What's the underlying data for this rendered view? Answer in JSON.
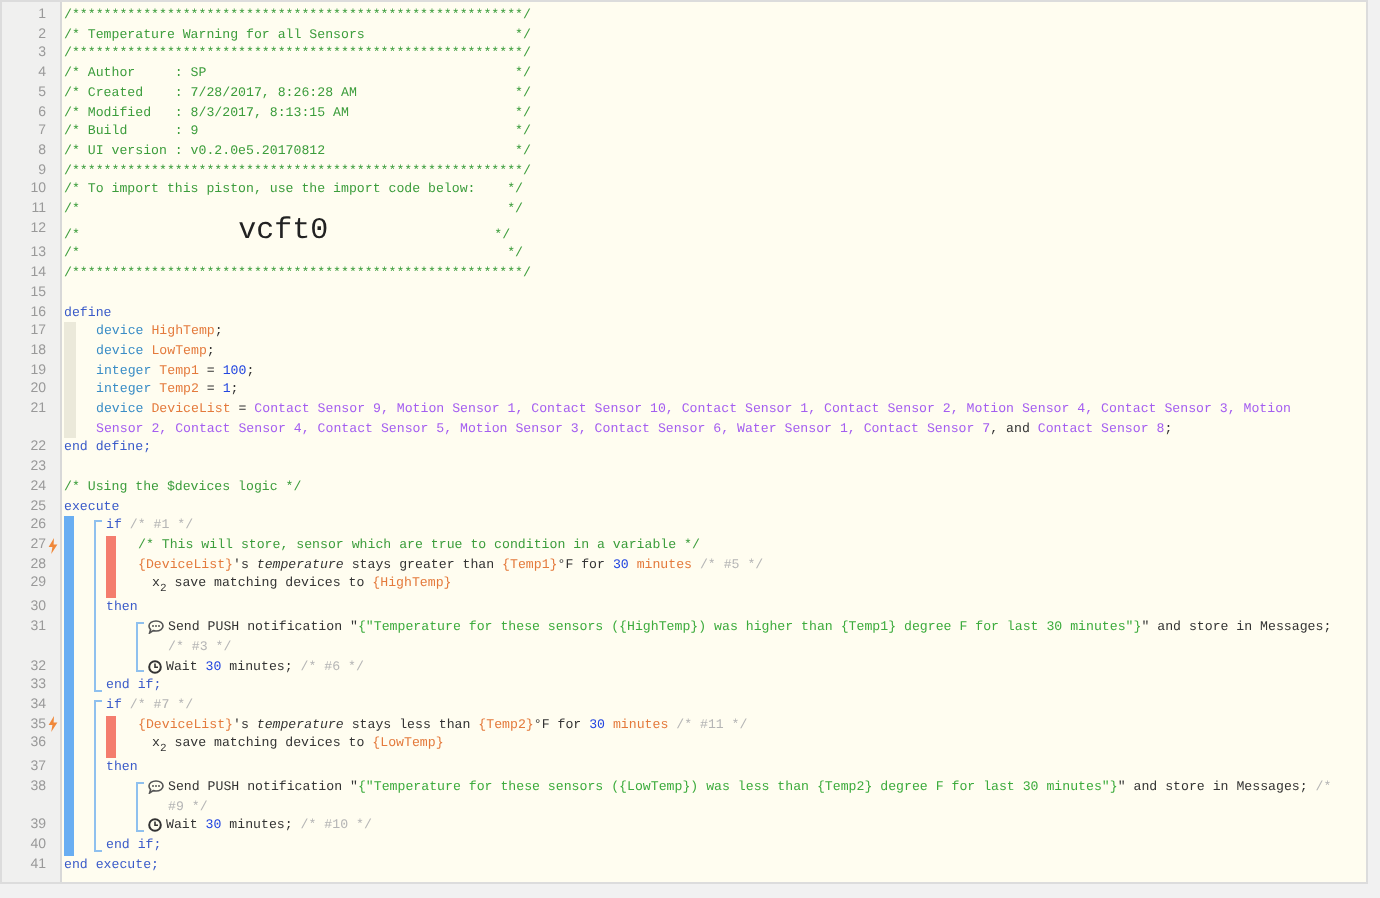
{
  "editor": {
    "lines": [
      {
        "kind": "line",
        "number": "1",
        "trigger": false,
        "segments": [
          {
            "kind": "comment",
            "text": "/*********************************************************/"
          }
        ]
      },
      {
        "kind": "line",
        "number": "2",
        "trigger": false,
        "segments": [
          {
            "kind": "comment",
            "text": "/* Temperature Warning for all Sensors                   */"
          }
        ]
      },
      {
        "kind": "line",
        "number": "3",
        "trigger": false,
        "segments": [
          {
            "kind": "comment",
            "text": "/*********************************************************/"
          }
        ]
      },
      {
        "kind": "line",
        "number": "4",
        "trigger": false,
        "segments": [
          {
            "kind": "comment",
            "text": "/* Author     : SP                                       */"
          }
        ]
      },
      {
        "kind": "line",
        "number": "5",
        "trigger": false,
        "segments": [
          {
            "kind": "comment",
            "text": "/* Created    : 7/28/2017, 8:26:28 AM                    */"
          }
        ]
      },
      {
        "kind": "line",
        "number": "6",
        "trigger": false,
        "segments": [
          {
            "kind": "comment",
            "text": "/* Modified   : 8/3/2017, 8:13:15 AM                     */"
          }
        ]
      },
      {
        "kind": "line",
        "number": "7",
        "trigger": false,
        "segments": [
          {
            "kind": "comment",
            "text": "/* Build      : 9                                        */"
          }
        ]
      },
      {
        "kind": "line",
        "number": "8",
        "trigger": false,
        "segments": [
          {
            "kind": "comment",
            "text": "/* UI version : v0.2.0e5.20170812                        */"
          }
        ]
      },
      {
        "kind": "line",
        "number": "9",
        "trigger": false,
        "segments": [
          {
            "kind": "comment",
            "text": "/*********************************************************/"
          }
        ]
      },
      {
        "kind": "line",
        "number": "10",
        "trigger": false,
        "segments": [
          {
            "kind": "comment",
            "text": "/* To import this piston, use the import code below:    */"
          }
        ]
      },
      {
        "kind": "line",
        "number": "11",
        "trigger": false,
        "segments": [
          {
            "kind": "comment",
            "text": "/*                                                      */"
          }
        ]
      },
      {
        "kind": "line",
        "number": "12",
        "trigger": false,
        "segments": [
          {
            "kind": "comment",
            "text": "/*                    "
          },
          {
            "kind": "code",
            "text": "vcft0"
          },
          {
            "kind": "comment",
            "text": "                     */"
          }
        ]
      },
      {
        "kind": "line",
        "number": "13",
        "trigger": false,
        "segments": [
          {
            "kind": "comment",
            "text": "/*                                                      */"
          }
        ]
      },
      {
        "kind": "line",
        "number": "14",
        "trigger": false,
        "segments": [
          {
            "kind": "comment",
            "text": "/*********************************************************/"
          }
        ]
      },
      {
        "kind": "line",
        "number": "15",
        "trigger": false
      },
      {
        "kind": "line",
        "number": "16",
        "trigger": false,
        "segments": [
          {
            "kind": "keyword",
            "text": "define"
          }
        ]
      },
      {
        "kind": "define",
        "children": [
          {
            "kind": "line",
            "number": "17",
            "trigger": false,
            "segments": [
              {
                "kind": "type",
                "text": "device "
              },
              {
                "kind": "var",
                "text": "HighTemp"
              },
              {
                "kind": "plain",
                "text": ";"
              }
            ]
          },
          {
            "kind": "line",
            "number": "18",
            "trigger": false,
            "segments": [
              {
                "kind": "type",
                "text": "device "
              },
              {
                "kind": "var",
                "text": "LowTemp"
              },
              {
                "kind": "plain",
                "text": ";"
              }
            ]
          },
          {
            "kind": "line",
            "number": "19",
            "trigger": false,
            "segments": [
              {
                "kind": "type",
                "text": "integer "
              },
              {
                "kind": "var",
                "text": "Temp1"
              },
              {
                "kind": "plain",
                "text": " = "
              },
              {
                "kind": "number",
                "text": "100"
              },
              {
                "kind": "plain",
                "text": ";"
              }
            ]
          },
          {
            "kind": "line",
            "number": "20",
            "trigger": false,
            "segments": [
              {
                "kind": "type",
                "text": "integer "
              },
              {
                "kind": "var",
                "text": "Temp2"
              },
              {
                "kind": "plain",
                "text": " = "
              },
              {
                "kind": "number",
                "text": "1"
              },
              {
                "kind": "plain",
                "text": ";"
              }
            ]
          },
          {
            "kind": "line",
            "number": "21",
            "trigger": false,
            "segments": [
              {
                "kind": "type",
                "text": "device "
              },
              {
                "kind": "var",
                "text": "DeviceList"
              },
              {
                "kind": "plain",
                "text": " = "
              },
              {
                "kind": "device",
                "text": "Contact Sensor 9, Motion Sensor 1, Contact Sensor 10, Contact Sensor 1, Contact Sensor 2, Motion Sensor 4, Contact Sensor 3, Motion Sensor 2, Contact Sensor 4, Contact Sensor 5, Motion Sensor 3, Contact Sensor 6, Water Sensor 1, Contact Sensor 7"
              },
              {
                "kind": "plain",
                "text": ", and "
              },
              {
                "kind": "device",
                "text": "Contact Sensor 8"
              },
              {
                "kind": "plain",
                "text": ";"
              }
            ]
          }
        ]
      },
      {
        "kind": "line",
        "number": "22",
        "trigger": false,
        "segments": [
          {
            "kind": "keyword",
            "text": "end define;"
          }
        ]
      },
      {
        "kind": "line",
        "number": "23",
        "trigger": false
      },
      {
        "kind": "line",
        "number": "24",
        "trigger": false,
        "segments": [
          {
            "kind": "comment",
            "text": "/* Using the $devices logic */"
          }
        ]
      },
      {
        "kind": "line",
        "number": "25",
        "trigger": false,
        "segments": [
          {
            "kind": "keyword",
            "text": "execute"
          }
        ]
      },
      {
        "kind": "execute",
        "children": [
          {
            "kind": "if",
            "children": [
              {
                "kind": "line",
                "number": "26",
                "trigger": false,
                "segments": [
                  {
                    "kind": "keyword",
                    "text": "if "
                  },
                  {
                    "kind": "faded",
                    "text": "/* #1 */"
                  }
                ]
              },
              {
                "kind": "condition",
                "children": [
                  {
                    "kind": "line",
                    "number": "27",
                    "trigger": true,
                    "segments": [
                      {
                        "kind": "comment",
                        "text": "/* This will store, sensor which are true to condition in a variable */"
                      }
                    ]
                  },
                  {
                    "kind": "line",
                    "number": "28",
                    "trigger": false,
                    "segments": [
                      {
                        "kind": "var",
                        "text": "{DeviceList}"
                      },
                      {
                        "kind": "plain",
                        "text": "'s "
                      },
                      {
                        "kind": "attr",
                        "text": "temperature"
                      },
                      {
                        "kind": "plain",
                        "text": " stays greater than "
                      },
                      {
                        "kind": "var",
                        "text": "{Temp1}"
                      },
                      {
                        "kind": "plain",
                        "text": "°F for "
                      },
                      {
                        "kind": "number",
                        "text": "30"
                      },
                      {
                        "kind": "var",
                        "text": " minutes"
                      },
                      {
                        "kind": "faded",
                        "text": " /* #5 */"
                      }
                    ]
                  },
                  {
                    "kind": "sub",
                    "children": [
                      {
                        "kind": "line",
                        "number": "29",
                        "trigger": false,
                        "segments": [
                          {
                            "kind": "plain",
                            "text": "x$_{2}$ save matching devices to "
                          },
                          {
                            "kind": "var",
                            "text": "{HighTemp}"
                          }
                        ]
                      }
                    ]
                  }
                ]
              },
              {
                "kind": "line",
                "number": "30",
                "trigger": false,
                "segments": [
                  {
                    "kind": "keyword",
                    "text": "then"
                  }
                ]
              },
              {
                "kind": "action",
                "children": [
                  {
                    "kind": "notify",
                    "number": "31",
                    "trigger": false,
                    "segments": [
                      {
                        "kind": "plain",
                        "text": "Send PUSH notification \""
                      },
                      {
                        "kind": "string",
                        "text": "{\"Temperature for these sensors ({HighTemp}) was higher than {Temp1} degree F for last 30 minutes\"}"
                      },
                      {
                        "kind": "plain",
                        "text": "\" and store in Messages; "
                      },
                      {
                        "kind": "faded",
                        "text": "/* #3 */"
                      }
                    ]
                  },
                  {
                    "kind": "wait",
                    "number": "32",
                    "trigger": false,
                    "segments": [
                      {
                        "kind": "plain",
                        "text": "Wait "
                      },
                      {
                        "kind": "number",
                        "text": "30"
                      },
                      {
                        "kind": "plain",
                        "text": " minutes; "
                      },
                      {
                        "kind": "faded",
                        "text": "/* #6 */"
                      }
                    ]
                  }
                ]
              },
              {
                "kind": "line",
                "number": "33",
                "trigger": false,
                "segments": [
                  {
                    "kind": "keyword",
                    "text": "end if;"
                  }
                ]
              }
            ]
          },
          {
            "kind": "if",
            "children": [
              {
                "kind": "line",
                "number": "34",
                "trigger": false,
                "segments": [
                  {
                    "kind": "keyword",
                    "text": "if "
                  },
                  {
                    "kind": "faded",
                    "text": "/* #7 */"
                  }
                ]
              },
              {
                "kind": "condition",
                "children": [
                  {
                    "kind": "line",
                    "number": "35",
                    "trigger": true,
                    "segments": [
                      {
                        "kind": "var",
                        "text": "{DeviceList}"
                      },
                      {
                        "kind": "plain",
                        "text": "'s "
                      },
                      {
                        "kind": "attr",
                        "text": "temperature"
                      },
                      {
                        "kind": "plain",
                        "text": " stays less than "
                      },
                      {
                        "kind": "var",
                        "text": "{Temp2}"
                      },
                      {
                        "kind": "plain",
                        "text": "°F for "
                      },
                      {
                        "kind": "number",
                        "text": "30"
                      },
                      {
                        "kind": "var",
                        "text": " minutes"
                      },
                      {
                        "kind": "faded",
                        "text": " /* #11 */"
                      }
                    ]
                  },
                  {
                    "kind": "sub",
                    "children": [
                      {
                        "kind": "line",
                        "number": "36",
                        "trigger": false,
                        "segments": [
                          {
                            "kind": "plain",
                            "text": "x$_{2}$ save matching devices to "
                          },
                          {
                            "kind": "var",
                            "text": "{LowTemp}"
                          }
                        ]
                      }
                    ]
                  }
                ]
              },
              {
                "kind": "line",
                "number": "37",
                "trigger": false,
                "segments": [
                  {
                    "kind": "keyword",
                    "text": "then"
                  }
                ]
              },
              {
                "kind": "action",
                "children": [
                  {
                    "kind": "notify",
                    "number": "38",
                    "trigger": false,
                    "segments": [
                      {
                        "kind": "plain",
                        "text": "Send PUSH notification \""
                      },
                      {
                        "kind": "string",
                        "text": "{\"Temperature for these sensors ({LowTemp}) was less than {Temp2} degree F for last 30 minutes\"}"
                      },
                      {
                        "kind": "plain",
                        "text": "\" and store in Messages; "
                      },
                      {
                        "kind": "faded",
                        "text": "/* #9 */"
                      }
                    ]
                  },
                  {
                    "kind": "wait",
                    "number": "39",
                    "trigger": false,
                    "segments": [
                      {
                        "kind": "plain",
                        "text": "Wait "
                      },
                      {
                        "kind": "number",
                        "text": "30"
                      },
                      {
                        "kind": "plain",
                        "text": " minutes; "
                      },
                      {
                        "kind": "faded",
                        "text": "/* #10 */"
                      }
                    ]
                  }
                ]
              },
              {
                "kind": "line",
                "number": "40",
                "trigger": false,
                "segments": [
                  {
                    "kind": "keyword",
                    "text": "end if;"
                  }
                ]
              }
            ]
          }
        ]
      },
      {
        "kind": "line",
        "number": "41",
        "trigger": false,
        "segments": [
          {
            "kind": "keyword",
            "text": "end execute;"
          }
        ]
      }
    ]
  }
}
